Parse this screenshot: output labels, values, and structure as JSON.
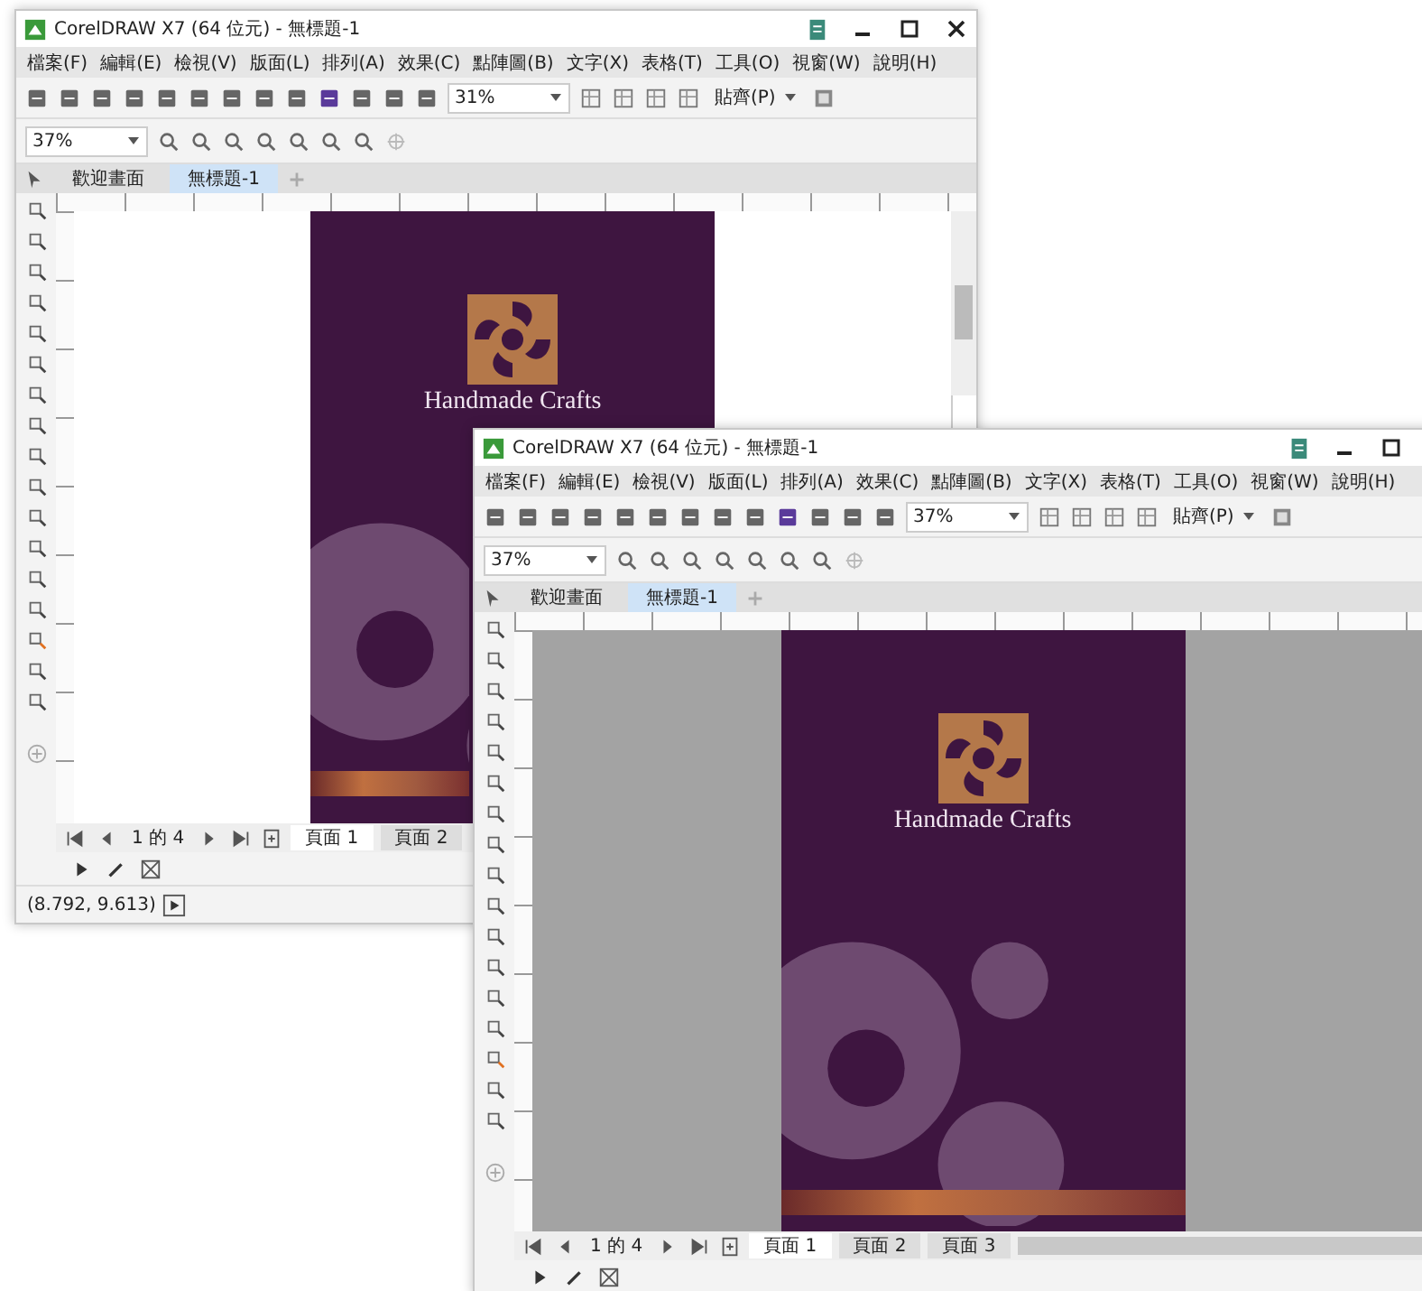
{
  "windows": [
    {
      "title": "CorelDRAW X7 (64 位元) - 無標題-1",
      "menu": [
        "檔案(F)",
        "編輯(E)",
        "檢視(V)",
        "版面(L)",
        "排列(A)",
        "效果(C)",
        "點陣圖(B)",
        "文字(X)",
        "表格(T)",
        "工具(O)",
        "視窗(W)",
        "說明(H)"
      ],
      "standard_zoom": "31%",
      "snap": "貼齊(P)",
      "property_zoom": "37%",
      "doc_tabs": [
        {
          "label": "歡迎畫面",
          "selected": false
        },
        {
          "label": "無標題-1",
          "selected": true
        }
      ],
      "page_counter": "1 的 4",
      "page_tabs": [
        {
          "label": "頁面 1",
          "selected": true
        },
        {
          "label": "頁面 2",
          "selected": false
        }
      ],
      "coordinates": "(8.792, 9.613)",
      "canvas_shaded": false,
      "artwork_title": "Handmade Crafts"
    },
    {
      "title": "CorelDRAW X7 (64 位元) - 無標題-1",
      "menu": [
        "檔案(F)",
        "編輯(E)",
        "檢視(V)",
        "版面(L)",
        "排列(A)",
        "效果(C)",
        "點陣圖(B)",
        "文字(X)",
        "表格(T)",
        "工具(O)",
        "視窗(W)",
        "說明(H)"
      ],
      "standard_zoom": "37%",
      "snap": "貼齊(P)",
      "property_zoom": "37%",
      "doc_tabs": [
        {
          "label": "歡迎畫面",
          "selected": false
        },
        {
          "label": "無標題-1",
          "selected": true
        }
      ],
      "page_counter": "1 的 4",
      "page_tabs": [
        {
          "label": "頁面 1",
          "selected": true
        },
        {
          "label": "頁面 2",
          "selected": false
        },
        {
          "label": "頁面 3",
          "selected": false
        }
      ],
      "canvas_shaded": true,
      "artwork_title": "Handmade Crafts"
    }
  ]
}
